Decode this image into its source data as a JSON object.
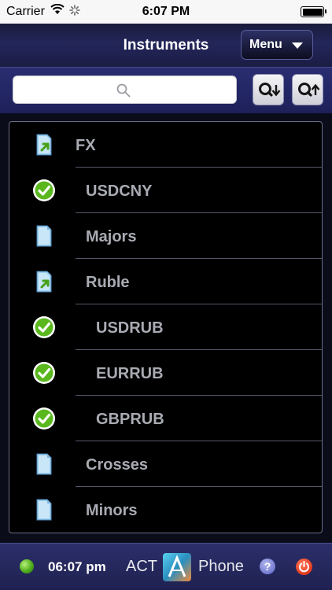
{
  "status_bar": {
    "carrier": "Carrier",
    "time": "6:07 PM"
  },
  "nav": {
    "title": "Instruments",
    "menu_label": "Menu"
  },
  "search": {
    "placeholder": ""
  },
  "list": {
    "items": [
      {
        "label": "FX",
        "icon": "folder-open-icon",
        "level": 0
      },
      {
        "label": "USDCNY",
        "icon": "check-circle-icon",
        "level": 1
      },
      {
        "label": "Majors",
        "icon": "folder-icon",
        "level": 1
      },
      {
        "label": "Ruble",
        "icon": "folder-open-icon",
        "level": 1
      },
      {
        "label": "USDRUB",
        "icon": "check-circle-icon",
        "level": 2
      },
      {
        "label": "EURRUB",
        "icon": "check-circle-icon",
        "level": 2
      },
      {
        "label": "GBPRUB",
        "icon": "check-circle-icon",
        "level": 2
      },
      {
        "label": "Crosses",
        "icon": "folder-icon",
        "level": 1
      },
      {
        "label": "Minors",
        "icon": "folder-icon",
        "level": 1
      }
    ]
  },
  "bottom_bar": {
    "clock": "06:07 pm",
    "brand_left": "ACT",
    "brand_right": "Phone",
    "help_glyph": "?"
  }
}
